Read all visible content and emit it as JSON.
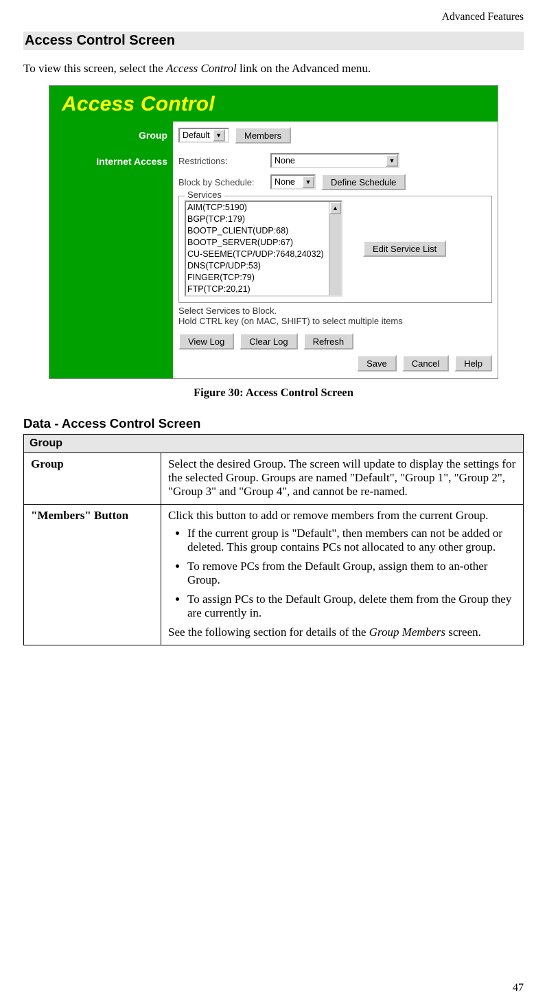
{
  "header_right": "Advanced Features",
  "section_title": "Access Control Screen",
  "intro_before": "To view this screen, select the ",
  "intro_em": "Access Control",
  "intro_after": " link on the Advanced menu.",
  "screenshot": {
    "title": "Access Control",
    "side_group": "Group",
    "side_internet": "Internet Access",
    "group_select": "Default",
    "members_btn": "Members",
    "restrictions_label": "Restrictions:",
    "restrictions_value": "None",
    "block_label": "Block by Schedule:",
    "block_value": "None",
    "define_schedule_btn": "Define Schedule",
    "services_legend": "Services",
    "services": [
      "AIM(TCP:5190)",
      "BGP(TCP:179)",
      "BOOTP_CLIENT(UDP:68)",
      "BOOTP_SERVER(UDP:67)",
      "CU-SEEME(TCP/UDP:7648,24032)",
      "DNS(TCP/UDP:53)",
      "FINGER(TCP:79)",
      "FTP(TCP:20,21)"
    ],
    "edit_service_btn": "Edit Service List",
    "note_line1": "Select Services to Block.",
    "note_line2": "Hold CTRL key (on MAC, SHIFT) to select multiple items",
    "view_log_btn": "View Log",
    "clear_log_btn": "Clear Log",
    "refresh_btn": "Refresh",
    "save_btn": "Save",
    "cancel_btn": "Cancel",
    "help_btn": "Help"
  },
  "figcaption": "Figure 30: Access Control Screen",
  "subheading": "Data - Access Control Screen",
  "table": {
    "group_header": "Group",
    "row1_label": "Group",
    "row1_desc": "Select the desired Group. The screen will update to display the settings for the selected Group. Groups are named \"Default\", \"Group 1\", \"Group 2\", \"Group 3\" and \"Group 4\", and cannot be re-named.",
    "row2_label": "\"Members\" Button",
    "row2_lead": "Click this button to add or remove members from the current Group.",
    "row2_b1": "If the current group is \"Default\", then members can not be added or deleted. This group contains PCs not allocated to any other group.",
    "row2_b2": "To remove PCs from the Default Group, assign them to an-other Group.",
    "row2_b3": "To assign PCs to the Default Group, delete them from the Group they are currently in.",
    "row2_tail_before": "See the following section for details of the ",
    "row2_tail_em": "Group Members",
    "row2_tail_after": " screen."
  },
  "page_number": "47"
}
